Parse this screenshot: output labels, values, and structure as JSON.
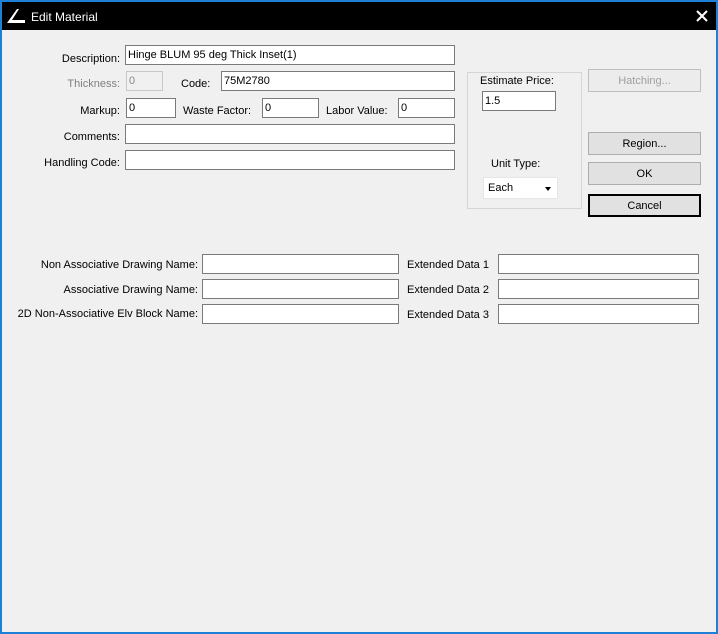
{
  "window": {
    "title": "Edit Material",
    "close_glyph": "✕"
  },
  "form": {
    "description": {
      "label": "Description:",
      "value": "Hinge BLUM 95 deg Thick Inset(1)"
    },
    "thickness": {
      "label": "Thickness:",
      "value": "0"
    },
    "code": {
      "label": "Code:",
      "value": "75M2780"
    },
    "markup": {
      "label": "Markup:",
      "value": "0"
    },
    "waste_factor": {
      "label": "Waste Factor:",
      "value": "0"
    },
    "labor_value": {
      "label": "Labor Value:",
      "value": "0"
    },
    "comments": {
      "label": "Comments:",
      "value": ""
    },
    "handling_code": {
      "label": "Handling Code:",
      "value": ""
    }
  },
  "estimate": {
    "price_label": "Estimate Price:",
    "price_value": "1.5",
    "unit_type_label": "Unit Type:",
    "unit_type_value": "Each"
  },
  "buttons": {
    "hatching": "Hatching...",
    "region": "Region...",
    "ok": "OK",
    "cancel": "Cancel"
  },
  "drawing": {
    "non_assoc_name": {
      "label": "Non Associative Drawing Name:",
      "value": ""
    },
    "assoc_name": {
      "label": "Associative Drawing Name:",
      "value": ""
    },
    "block_name": {
      "label": "2D Non-Associative Elv Block Name:",
      "value": ""
    },
    "extended_1": {
      "label": "Extended Data 1",
      "value": ""
    },
    "extended_2": {
      "label": "Extended Data 2",
      "value": ""
    },
    "extended_3": {
      "label": "Extended Data 3",
      "value": ""
    }
  },
  "icons": {
    "app": "app-logo-icon",
    "close": "close-icon",
    "dropdown": "chevron-down-icon"
  }
}
